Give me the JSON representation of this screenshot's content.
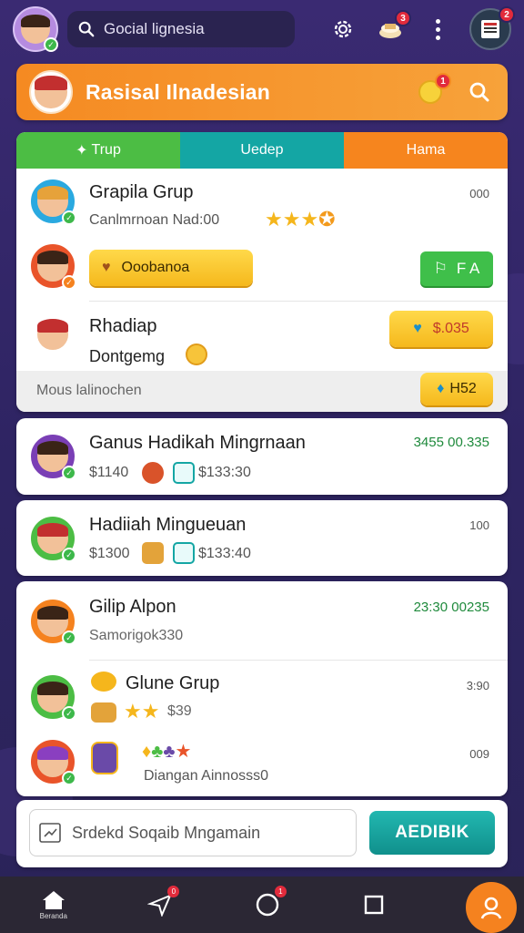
{
  "topbar": {
    "search_text": "Gocial lignesia",
    "bell_badge": "3",
    "profile_badge": "2",
    "icons": [
      "search-icon",
      "gear-icon",
      "cake-icon",
      "more-icon"
    ]
  },
  "header": {
    "title": "Rasisal Ilnadesian",
    "notif_badge": "1"
  },
  "tabs": [
    {
      "label": "Trup",
      "color": "#4cbd44"
    },
    {
      "label": "Uedep",
      "color": "#14a6a4"
    },
    {
      "label": "Hama",
      "color": "#f6851e"
    }
  ],
  "panel1": {
    "row1": {
      "name": "Grapila Grup",
      "sub": "Canlmrnoan Nad:00",
      "meta": "000"
    },
    "row2": {
      "button_label": "Ooobanoa",
      "green_label": "F A"
    },
    "row3": {
      "name": "Rhadiap",
      "sub": "Dontgemg",
      "price": "$.035"
    },
    "row4": {
      "sub": "Mous lalinochen",
      "chip": "H52"
    }
  },
  "cards": [
    {
      "name": "Ganus Hadikah Mingrnaan",
      "meta": "3455 00.335",
      "amount": "$1140",
      "amount2": "$133:30"
    },
    {
      "name": "Hadiiah Mingueuan",
      "meta": "100",
      "amount": "$1300",
      "amount2": "$133:40"
    }
  ],
  "panel3": {
    "row1": {
      "name": "Gilip Alpon",
      "sub": "Samorigok330",
      "meta": "23:30 00235"
    },
    "row2": {
      "name": "Glune Grup",
      "sub": "$39",
      "meta": "3:90"
    },
    "row3": {
      "sub": "Diangan Ainnosss0",
      "meta": "009"
    }
  },
  "composer": {
    "placeholder": "Srdekd Soqaib Mngamain",
    "send_label": "AEDIBIK"
  },
  "nav": {
    "home_label": "Beranda",
    "send_badge": "0",
    "circle_badge": "1"
  },
  "colors": {
    "accent_orange": "#f58a22",
    "accent_teal": "#14a6a4",
    "accent_green": "#4cbd44"
  }
}
